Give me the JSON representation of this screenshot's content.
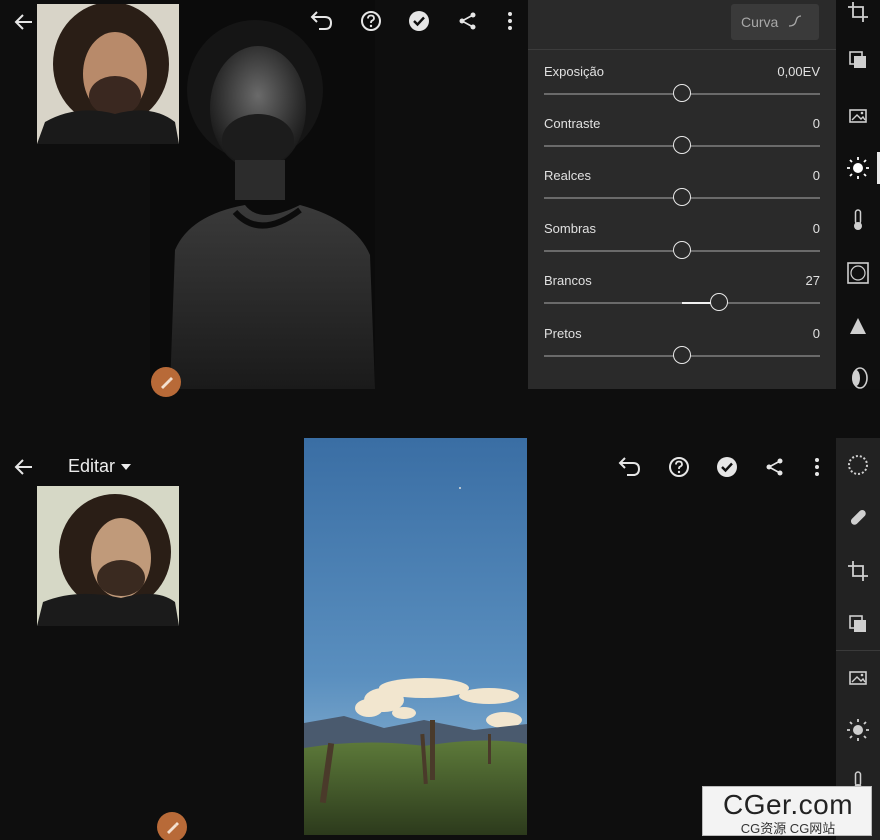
{
  "top_screen": {
    "curve_button_label": "Curva",
    "sliders": [
      {
        "label": "Exposição",
        "value": "0,00EV",
        "position": 0.5
      },
      {
        "label": "Contraste",
        "value": "0",
        "position": 0.5
      },
      {
        "label": "Realces",
        "value": "0",
        "position": 0.5
      },
      {
        "label": "Sombras",
        "value": "0",
        "position": 0.5
      },
      {
        "label": "Brancos",
        "value": "27",
        "position": 0.635
      },
      {
        "label": "Pretos",
        "value": "0",
        "position": 0.5
      }
    ]
  },
  "bottom_screen": {
    "edit_title": "Editar"
  },
  "icons": {
    "back": "back-arrow-icon",
    "undo": "undo-icon",
    "help": "help-icon",
    "done": "checkmark-icon",
    "share": "share-icon",
    "more": "more-vertical-icon",
    "brush": "brush-icon"
  },
  "toolbar_tools_top": [
    "crop-icon",
    "presets-icon",
    "auto-icon",
    "light-icon",
    "color-temperature-icon",
    "vignette-icon",
    "detail-icon",
    "optics-icon"
  ],
  "toolbar_tools_bottom": [
    "selective-icon",
    "healing-icon",
    "crop-icon",
    "presets-icon",
    "auto-icon",
    "light-icon",
    "color-temperature-icon"
  ],
  "colors": {
    "brush_button": "#b86a38",
    "panel": "#2a2a2a",
    "background": "#0e0e0e"
  },
  "watermark": {
    "brand": "CGer.com",
    "tagline": "CG资源 CG网站"
  }
}
